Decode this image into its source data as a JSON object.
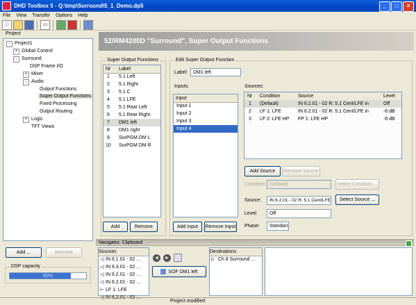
{
  "window": {
    "title": "DHD Toolbox 5 - Q:\\tmp\\Surround\\5_1_Demo.dp5"
  },
  "menu": [
    "File",
    "View",
    "Transfer",
    "Options",
    "Help"
  ],
  "project_panel": {
    "header": "Project",
    "tree": [
      {
        "label": "Project1",
        "level": 0,
        "expander": "-"
      },
      {
        "label": "Global Control",
        "level": 1,
        "expander": "+"
      },
      {
        "label": "Surround",
        "level": 1,
        "expander": "-"
      },
      {
        "label": "DSP Frame I/O",
        "level": 2,
        "expander": ""
      },
      {
        "label": "Mixer",
        "level": 2,
        "expander": "+"
      },
      {
        "label": "Audio",
        "level": 2,
        "expander": "-"
      },
      {
        "label": "Output Functions",
        "level": 3,
        "expander": ""
      },
      {
        "label": "Super Output Functions",
        "level": 3,
        "expander": "",
        "selected": true
      },
      {
        "label": "Fixed Processing",
        "level": 3,
        "expander": ""
      },
      {
        "label": "Output Routing",
        "level": 3,
        "expander": ""
      },
      {
        "label": "Logic",
        "level": 2,
        "expander": "+"
      },
      {
        "label": "TFT Views",
        "level": 2,
        "expander": ""
      }
    ],
    "add_label": "Add ...",
    "remove_label": "Remove",
    "dsp_capacity_label": "DSP capacity",
    "dsp_capacity_value": "80%",
    "dsp_capacity_fraction": 0.8
  },
  "banner": {
    "title": "52/RM4200D \"Surround\", Super Output Functions"
  },
  "sof_list": {
    "caption": "Super Output Functions",
    "col_nr": "Nr",
    "col_label": "Label",
    "rows": [
      {
        "nr": "1",
        "label": "5.1 Left"
      },
      {
        "nr": "2",
        "label": "5.1 Right"
      },
      {
        "nr": "3",
        "label": "5.1 C"
      },
      {
        "nr": "4",
        "label": "5.1 LFE"
      },
      {
        "nr": "5",
        "label": "5.1 Rear Left"
      },
      {
        "nr": "6",
        "label": "5.1 Rear Right"
      },
      {
        "nr": "7",
        "label": "DM1 left",
        "selected": true
      },
      {
        "nr": "8",
        "label": "DM1 right"
      },
      {
        "nr": "9",
        "label": "SurPGM DM L"
      },
      {
        "nr": "10",
        "label": "SurPGM DM R"
      }
    ],
    "add_label": "Add",
    "remove_label": "Remove"
  },
  "edit": {
    "caption": "Edit Super Output Function",
    "label_caption": "Label:",
    "label_value": "DM1 left",
    "inputs_caption": "Inputs:",
    "inputs_col": "Input",
    "inputs": [
      {
        "label": "Input 1"
      },
      {
        "label": "Input 2"
      },
      {
        "label": "Input 3"
      },
      {
        "label": "Input 4",
        "selected": true
      }
    ],
    "add_input_label": "Add Input",
    "remove_input_label": "Remove Input",
    "sources_caption": "Sources:",
    "sources_cols": {
      "nr": "Nr",
      "condition": "Condition",
      "source": "Source",
      "level": "Level"
    },
    "sources": [
      {
        "nr": "1",
        "condition": "(Default)",
        "source": "IN 6.2.01 - 02 R: 5.1 Cent/LFE in",
        "level": "Off"
      },
      {
        "nr": "2",
        "condition": "LF 1: LFE",
        "source": "IN 6.2.01 - 02 R: 5.1 Cent/LFE in",
        "level": "-6 dB"
      },
      {
        "nr": "3",
        "condition": "LF 2: LFE HP",
        "source": "FP 1: LFE HP",
        "level": "-6 dB"
      }
    ],
    "add_source_label": "Add Source",
    "remove_source_label": "Remove Source",
    "condition_caption": "Condition:",
    "condition_value": "(Default)",
    "select_condition_label": "Select Condition ...",
    "source_caption": "Source:",
    "source_value": "IN 6.2.01 - 02 R: 5.1 Cent/LFE in",
    "select_source_label": "Select Source ...",
    "level_caption": "Level:",
    "level_value": "Off",
    "phase_caption": "Phase:",
    "phase_value": "Standard"
  },
  "navigator": {
    "title": "Navigator, Clipboard",
    "sources_header": "Sources",
    "sources": [
      "IN 6.1.01 - 02 ...",
      "IN 6.3.01 - 02 ...",
      "IN 6.2.01 - 02 ...",
      "IN 6.2.01 - 02 ...",
      "LF 1: LFE",
      "IN 6.2.01 - 02 ..."
    ],
    "clip_item": "SOF DM1 left",
    "destinations_header": "Destinations",
    "destinations": [
      "Ch 8 Surround ..."
    ]
  },
  "status": {
    "text": "Project modified"
  }
}
